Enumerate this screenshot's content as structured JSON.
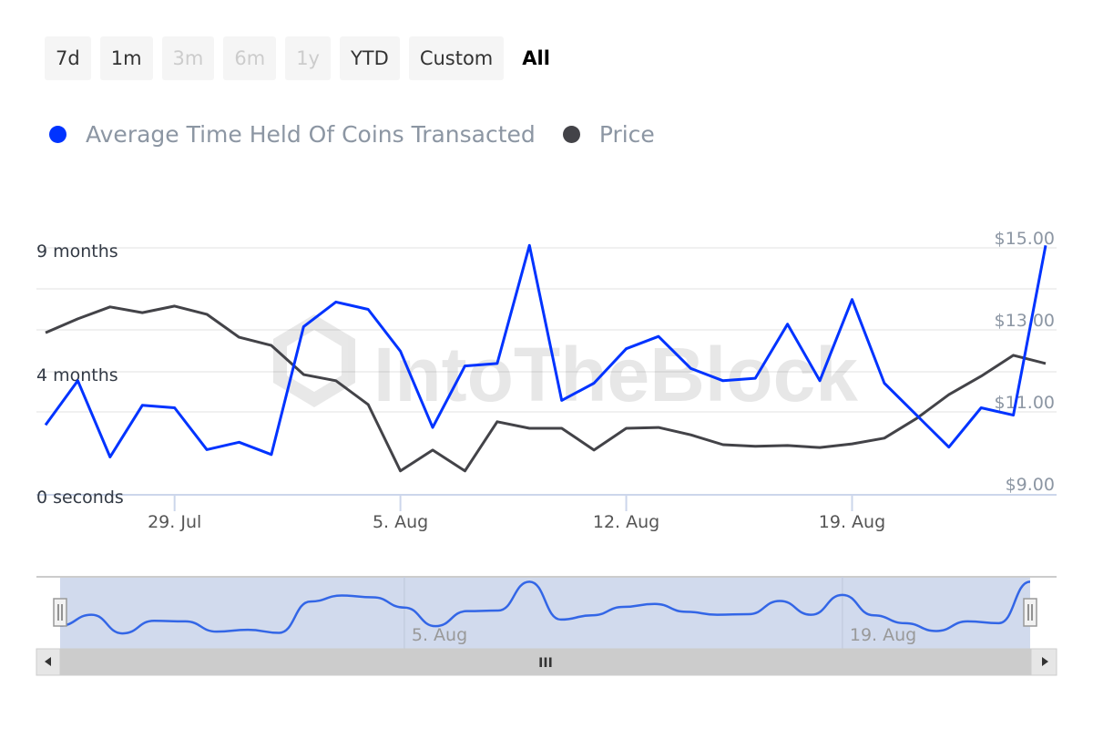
{
  "range_selector": {
    "buttons": [
      {
        "label": "7d",
        "state": "enabled"
      },
      {
        "label": "1m",
        "state": "enabled"
      },
      {
        "label": "3m",
        "state": "disabled"
      },
      {
        "label": "6m",
        "state": "disabled"
      },
      {
        "label": "1y",
        "state": "disabled"
      },
      {
        "label": "YTD",
        "state": "enabled"
      },
      {
        "label": "Custom",
        "state": "enabled"
      },
      {
        "label": "All",
        "state": "active"
      }
    ]
  },
  "watermark": "IntoTheBlock",
  "navigator": {
    "x_labels": [
      "5. Aug",
      "19. Aug"
    ],
    "scrollbar_grip": "III"
  },
  "chart_data": {
    "type": "line",
    "title": "",
    "x": [
      "25 Jul",
      "26 Jul",
      "27 Jul",
      "28 Jul",
      "29 Jul",
      "30 Jul",
      "31 Jul",
      "1 Aug",
      "2 Aug",
      "3 Aug",
      "4 Aug",
      "5 Aug",
      "6 Aug",
      "7 Aug",
      "8 Aug",
      "9 Aug",
      "10 Aug",
      "11 Aug",
      "12 Aug",
      "13 Aug",
      "14 Aug",
      "15 Aug",
      "16 Aug",
      "17 Aug",
      "18 Aug",
      "19 Aug",
      "20 Aug",
      "21 Aug",
      "22 Aug",
      "23 Aug",
      "24 Aug",
      "25 Aug"
    ],
    "x_ticks": [
      "29. Jul",
      "5. Aug",
      "12. Aug",
      "19. Aug"
    ],
    "x_tick_index": [
      4,
      11,
      18,
      25
    ],
    "legend_position": "top-left",
    "grid": true,
    "series": [
      {
        "name": "Average Time Held Of Coins Transacted",
        "color": "#0033ff",
        "axis": "left",
        "relative_level": [
          0.28,
          0.46,
          0.15,
          0.36,
          0.35,
          0.18,
          0.21,
          0.16,
          0.68,
          0.78,
          0.75,
          0.58,
          0.27,
          0.52,
          0.53,
          1.01,
          0.38,
          0.45,
          0.59,
          0.64,
          0.51,
          0.46,
          0.47,
          0.69,
          0.46,
          0.79,
          0.45,
          0.32,
          0.19,
          0.35,
          0.32,
          1.01
        ]
      },
      {
        "name": "Price",
        "color": "#434348",
        "axis": "right",
        "values": [
          12.93,
          13.27,
          13.56,
          13.42,
          13.58,
          13.38,
          12.82,
          12.62,
          11.91,
          11.76,
          11.18,
          9.56,
          10.07,
          9.56,
          10.76,
          10.6,
          10.6,
          10.07,
          10.6,
          10.62,
          10.44,
          10.2,
          10.16,
          10.18,
          10.13,
          10.22,
          10.36,
          10.84,
          11.42,
          11.87,
          12.38,
          12.18
        ]
      }
    ],
    "y_left": {
      "label": "",
      "ticks": [
        "9 months",
        "4 months",
        "0 seconds"
      ],
      "tick_level": [
        1.0,
        0.5,
        0.0
      ]
    },
    "y_right": {
      "label": "",
      "ticks": [
        "$15.00",
        "$13.00",
        "$11.00",
        "$9.00"
      ],
      "tick_values": [
        15,
        13,
        11,
        9
      ],
      "ylim": [
        9,
        15
      ]
    }
  }
}
